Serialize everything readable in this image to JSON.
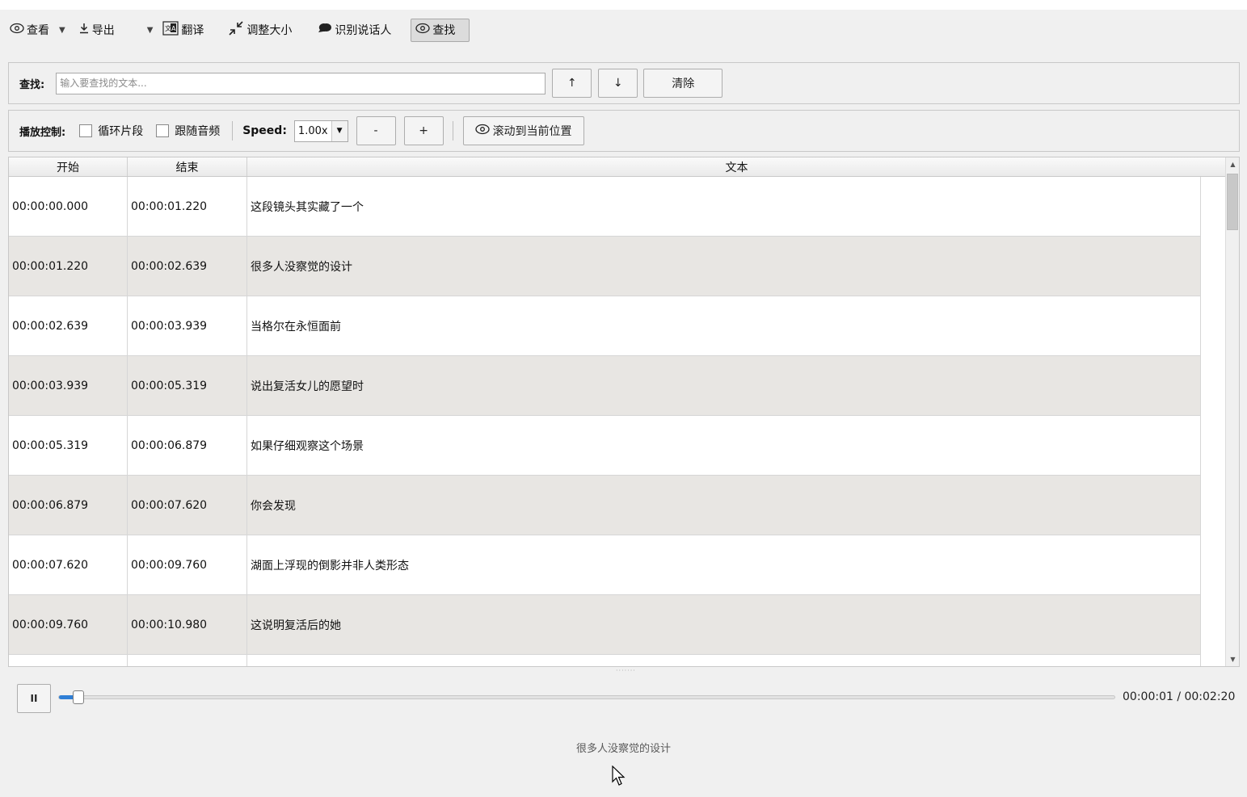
{
  "toolbar": {
    "view_label": "查看",
    "export_label": "导出",
    "translate_label": "翻译",
    "resize_label": "调整大小",
    "speaker_label": "识别说话人",
    "find_label": "查找"
  },
  "search": {
    "label": "查找:",
    "placeholder": "输入要查找的文本...",
    "up_label": "↑",
    "down_label": "↓",
    "clear_label": "清除"
  },
  "playback": {
    "label": "播放控制:",
    "loop_label": "循环片段",
    "follow_label": "跟随音频",
    "speed_label": "Speed:",
    "speed_value": "1.00x",
    "minus_label": "-",
    "plus_label": "+",
    "scroll_label": "滚动到当前位置"
  },
  "table": {
    "headers": {
      "start": "开始",
      "end": "结束",
      "text": "文本"
    },
    "rows": [
      {
        "start": "00:00:00.000",
        "end": "00:00:01.220",
        "text": "这段镜头其实藏了一个"
      },
      {
        "start": "00:00:01.220",
        "end": "00:00:02.639",
        "text": "很多人没察觉的设计"
      },
      {
        "start": "00:00:02.639",
        "end": "00:00:03.939",
        "text": "当格尔在永恒面前"
      },
      {
        "start": "00:00:03.939",
        "end": "00:00:05.319",
        "text": "说出复活女儿的愿望时"
      },
      {
        "start": "00:00:05.319",
        "end": "00:00:06.879",
        "text": "如果仔细观察这个场景"
      },
      {
        "start": "00:00:06.879",
        "end": "00:00:07.620",
        "text": "你会发现"
      },
      {
        "start": "00:00:07.620",
        "end": "00:00:09.760",
        "text": "湖面上浮现的倒影并非人类形态"
      },
      {
        "start": "00:00:09.760",
        "end": "00:00:10.980",
        "text": "这说明复活后的她"
      }
    ]
  },
  "player": {
    "pause_label": "II",
    "time": "00:00:01 / 00:02:20",
    "progress": 0.0118
  },
  "current_subtitle": "很多人没察觉的设计",
  "colors": {
    "accent": "#2f7fd6",
    "alt_row": "#e8e6e3"
  }
}
